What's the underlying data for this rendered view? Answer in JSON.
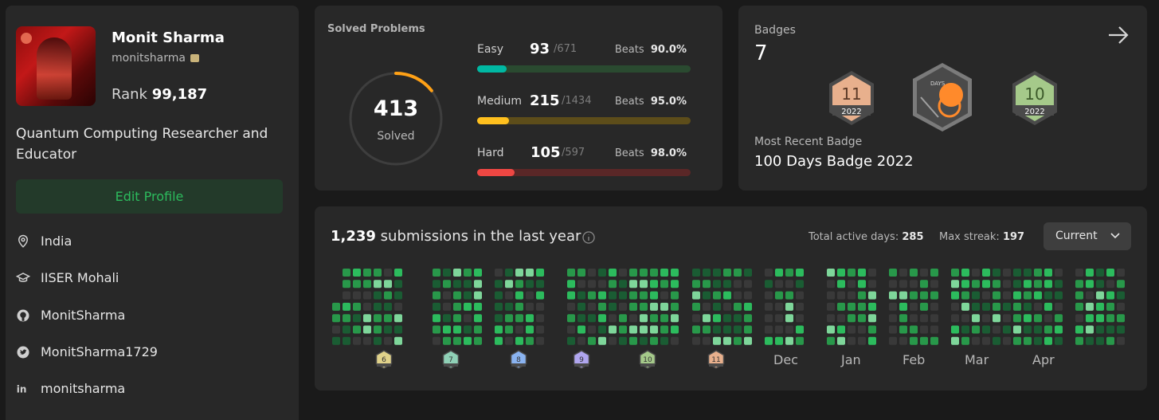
{
  "profile": {
    "name": "Monit Sharma",
    "username": "monitsharma",
    "rank_label": "Rank",
    "rank_value": "99,187",
    "bio": "Quantum Computing Researcher and Educator",
    "edit_label": "Edit Profile",
    "location": "India",
    "school": "IISER Mohali",
    "github": "MonitSharma",
    "twitter": "MonitSharma1729",
    "linkedin": "monitsharma"
  },
  "solved": {
    "title": "Solved Problems",
    "total": "413",
    "total_label": "Solved",
    "total_fraction": 0.144,
    "rows": [
      {
        "label": "Easy",
        "count": "93",
        "total": "/671",
        "beats_label": "Beats",
        "beats": "90.0%",
        "fraction": 0.139,
        "color": "#00b8a3",
        "track": "#2a4a30"
      },
      {
        "label": "Medium",
        "count": "215",
        "total": "/1434",
        "beats_label": "Beats",
        "beats": "95.0%",
        "fraction": 0.15,
        "color": "#ffc01e",
        "track": "#5d4d1a"
      },
      {
        "label": "Hard",
        "count": "105",
        "total": "/597",
        "beats_label": "Beats",
        "beats": "98.0%",
        "fraction": 0.176,
        "color": "#ef4743",
        "track": "#5a2727"
      }
    ]
  },
  "badges": {
    "title": "Badges",
    "count": "7",
    "recent_label": "Most Recent Badge",
    "recent_name": "100 Days Badge 2022",
    "items": [
      {
        "num": "11",
        "year": "2022",
        "color": "#e8b08d"
      },
      {
        "num": "DAYS",
        "year": "",
        "color": "#ff8a2b"
      },
      {
        "num": "10",
        "year": "2022",
        "color": "#a5c98a"
      }
    ]
  },
  "submissions": {
    "count": "1,239",
    "label": "submissions in the last year",
    "active_label": "Total active days:",
    "active_value": "285",
    "streak_label": "Max streak:",
    "streak_value": "197",
    "dropdown": "Current",
    "months": [
      "Dec",
      "Jan",
      "Feb",
      "Mar",
      "Apr"
    ],
    "month_badges": [
      {
        "num": "6",
        "color": "#e0d28a"
      },
      {
        "num": "7",
        "color": "#8fd0b6"
      },
      {
        "num": "8",
        "color": "#8ab3f0"
      },
      {
        "num": "9",
        "color": "#b0a6ef"
      },
      {
        "num": "10",
        "color": "#a5c98a"
      },
      {
        "num": "11",
        "color": "#e8b08d"
      }
    ],
    "palette": [
      "#393939",
      "#1a5c33",
      "#28984a",
      "#2cbb5d",
      "#7ed69a"
    ]
  }
}
